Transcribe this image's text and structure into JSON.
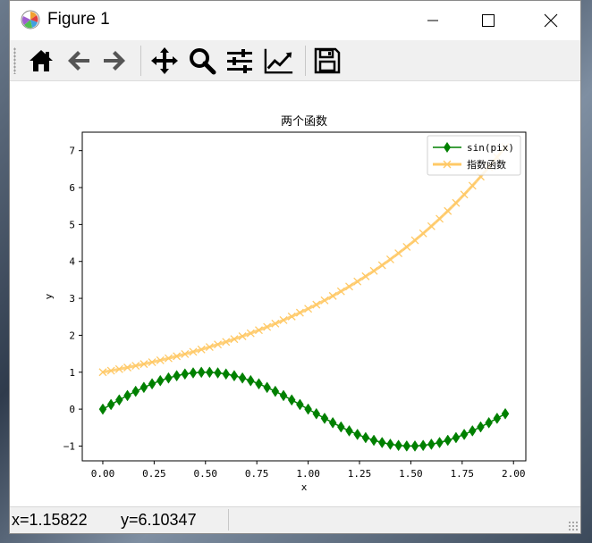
{
  "window": {
    "title": "Figure 1",
    "controls": [
      "minimize",
      "maximize",
      "close"
    ]
  },
  "toolbar": {
    "buttons": [
      {
        "name": "home",
        "icon": "home-icon"
      },
      {
        "name": "back",
        "icon": "arrow-left-icon"
      },
      {
        "name": "forward",
        "icon": "arrow-right-icon"
      },
      {
        "name": "pan",
        "icon": "move-icon"
      },
      {
        "name": "zoom",
        "icon": "magnifier-icon"
      },
      {
        "name": "configure-subplots",
        "icon": "sliders-icon"
      },
      {
        "name": "edit-axes",
        "icon": "line-chart-icon"
      },
      {
        "name": "save",
        "icon": "floppy-disk-icon"
      }
    ]
  },
  "status": {
    "x_readout": "x=1.15822",
    "y_readout": "y=6.10347"
  },
  "chart_data": {
    "type": "line",
    "title": "两个函数",
    "xlabel": "x",
    "ylabel": "y",
    "xlim": [
      -0.1,
      2.06
    ],
    "ylim": [
      -1.4,
      7.5
    ],
    "xticks": [
      0.0,
      0.25,
      0.5,
      0.75,
      1.0,
      1.25,
      1.5,
      1.75,
      2.0
    ],
    "xtick_labels": [
      "0.00",
      "0.25",
      "0.50",
      "0.75",
      "1.00",
      "1.25",
      "1.50",
      "1.75",
      "2.00"
    ],
    "yticks": [
      -1,
      0,
      1,
      2,
      3,
      4,
      5,
      6,
      7
    ],
    "ytick_labels": [
      "−1",
      "0",
      "1",
      "2",
      "3",
      "4",
      "5",
      "6",
      "7"
    ],
    "x": [
      0.0,
      0.04,
      0.08,
      0.12,
      0.16,
      0.2,
      0.24,
      0.28,
      0.32,
      0.36,
      0.4,
      0.44,
      0.48,
      0.52,
      0.56,
      0.6,
      0.64,
      0.68,
      0.72,
      0.76,
      0.8,
      0.84,
      0.88,
      0.92,
      0.96,
      1.0,
      1.04,
      1.08,
      1.12,
      1.16,
      1.2,
      1.24,
      1.28,
      1.32,
      1.36,
      1.4,
      1.44,
      1.48,
      1.52,
      1.56,
      1.6,
      1.64,
      1.68,
      1.72,
      1.76,
      1.8,
      1.84,
      1.88,
      1.92,
      1.96
    ],
    "series": [
      {
        "name": "sin(pix)",
        "color": "#008000",
        "marker": "diamond",
        "values": [
          0.0,
          0.125,
          0.249,
          0.368,
          0.482,
          0.588,
          0.685,
          0.771,
          0.844,
          0.905,
          0.951,
          0.982,
          0.998,
          0.998,
          0.982,
          0.951,
          0.905,
          0.844,
          0.771,
          0.685,
          0.588,
          0.482,
          0.368,
          0.249,
          0.125,
          0.0,
          -0.125,
          -0.249,
          -0.368,
          -0.482,
          -0.588,
          -0.685,
          -0.771,
          -0.844,
          -0.905,
          -0.951,
          -0.982,
          -0.998,
          -0.998,
          -0.982,
          -0.951,
          -0.905,
          -0.844,
          -0.771,
          -0.685,
          -0.588,
          -0.482,
          -0.368,
          -0.249,
          -0.125
        ]
      },
      {
        "name": "指数函数",
        "color": "#ffc966",
        "marker": "x",
        "values": [
          1.0,
          1.041,
          1.083,
          1.127,
          1.174,
          1.221,
          1.271,
          1.323,
          1.377,
          1.433,
          1.492,
          1.553,
          1.616,
          1.682,
          1.751,
          1.822,
          1.896,
          1.974,
          2.054,
          2.138,
          2.226,
          2.316,
          2.411,
          2.509,
          2.612,
          2.718,
          2.829,
          2.945,
          3.065,
          3.19,
          3.32,
          3.456,
          3.597,
          3.743,
          3.896,
          4.055,
          4.221,
          4.393,
          4.572,
          4.759,
          4.953,
          5.155,
          5.366,
          5.584,
          5.812,
          6.05,
          6.297,
          6.554,
          6.821,
          7.099
        ]
      }
    ],
    "legend": {
      "position": "upper right",
      "entries": [
        "sin(pix)",
        "指数函数"
      ]
    },
    "grid": false
  }
}
